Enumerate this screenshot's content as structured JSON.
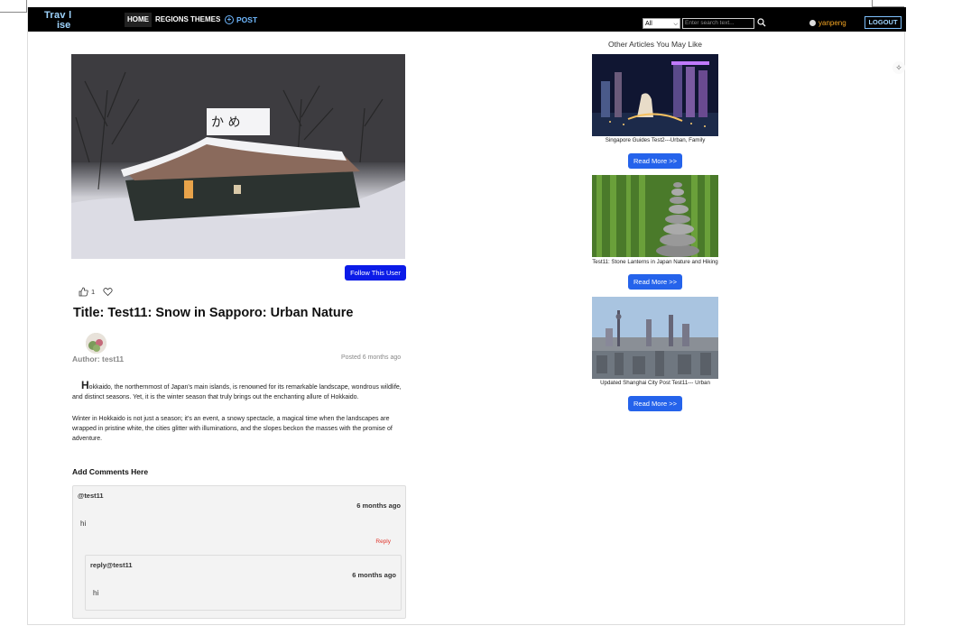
{
  "nav": {
    "logo_line1": "Trav l",
    "logo_line2": "ise",
    "home": "HOME",
    "regions": "REGIONS",
    "themes": "THEMES",
    "post": "POST",
    "search_scope": "All",
    "search_placeholder": "Enter search text...",
    "username": "yanpeng",
    "logout": "LOGOUT"
  },
  "article": {
    "follow_label": "Follow This User",
    "like_count": "1",
    "title": "Title: Test11: Snow in Sapporo: Urban Nature",
    "author": "Author: test11",
    "posted": "Posted 6 months ago",
    "para1_drop": "H",
    "para1_rest": "okkaido, the northernmost of Japan's main islands, is renowned for its remarkable landscape, wondrous wildlife, and distinct seasons. Yet, it is the winter season that truly brings out the enchanting allure of Hokkaido.",
    "para2": "Winter in Hokkaido is not just a season; it's an event, a snowy spectacle, a magical time when the landscapes are wrapped in pristine white, the cities glitter with illuminations, and the slopes beckon the masses with the promise of adventure."
  },
  "comments": {
    "heading": "Add Comments Here",
    "items": [
      {
        "user": "@test11",
        "time": "6 months ago",
        "text": "hi",
        "reply_label": "Reply",
        "reply": {
          "user": "reply@test11",
          "time": "6 months ago",
          "text": "hi"
        }
      }
    ]
  },
  "sidebar": {
    "title": "Other Articles You May Like",
    "articles": [
      {
        "caption": "Singapore Guides Test2---Urban, Family",
        "button": "Read More >>"
      },
      {
        "caption": "Test11: Stone Lanterns in Japan Nature and Hiking",
        "button": "Read More >>"
      },
      {
        "caption": "Updated Shanghai City Post Test11--- Urban",
        "button": "Read More >>"
      }
    ]
  },
  "colors": {
    "navbar_bg": "#000000",
    "follow_button": "#0b1be8",
    "read_more_button": "#2563eb",
    "username": "#f5a623",
    "reply_link": "#e0342b"
  }
}
